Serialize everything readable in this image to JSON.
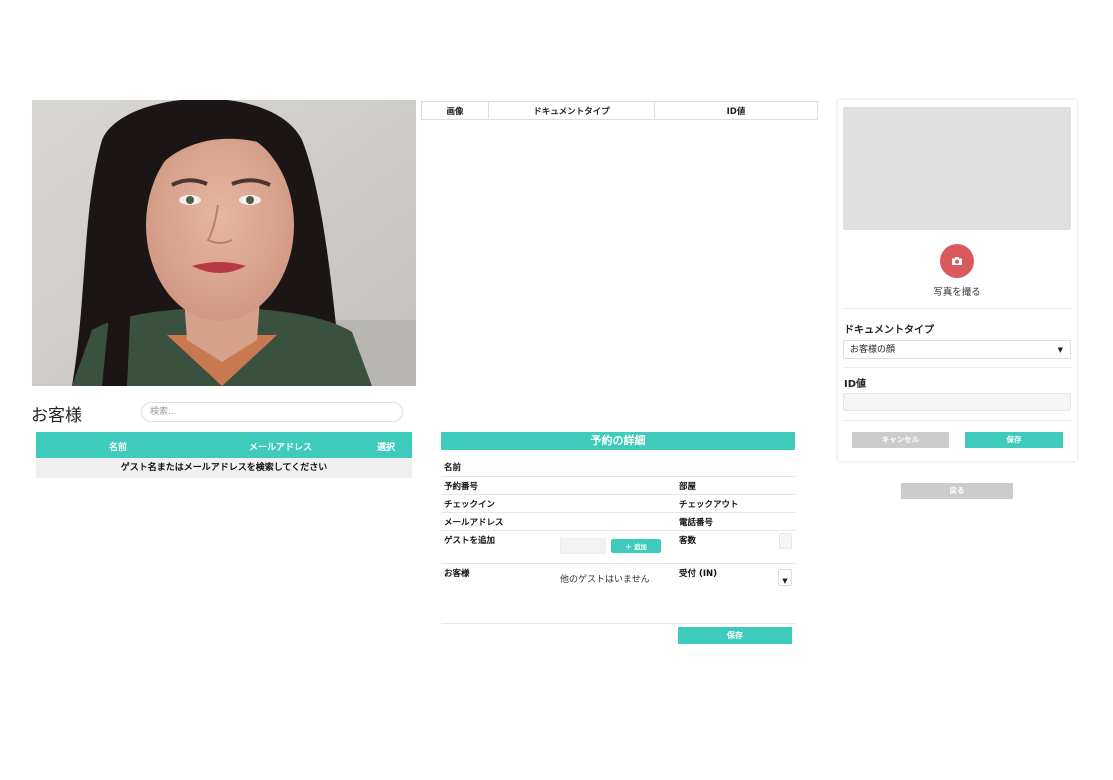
{
  "guests": {
    "title": "お客様",
    "search_placeholder": "検索...",
    "columns": [
      "名前",
      "メールアドレス",
      "選択"
    ],
    "empty_message": "ゲスト名またはメールアドレスを検索してください"
  },
  "documents": {
    "columns": [
      "画像",
      "ドキュメントタイプ",
      "ID値"
    ]
  },
  "reservation": {
    "title": "予約の詳細",
    "name_label": "名前",
    "number_label": "予約番号",
    "room_label": "部屋",
    "checkin_label": "チェックイン",
    "checkout_label": "チェックアウト",
    "email_label": "メールアドレス",
    "phone_label": "電話番号",
    "add_guest_label": "ゲストを追加",
    "add_button": "＋ 追加",
    "guest_count_label": "客数",
    "guests_label": "お客様",
    "no_guests": "他のゲストはいません",
    "reception_label": "受付 (IN)",
    "save_button": "保存"
  },
  "capture": {
    "take_photo_label": "写真を撮る",
    "doctype_label": "ドキュメントタイプ",
    "doctype_value": "お客様の顔",
    "idval_label": "ID値",
    "cancel_button": "キャンセル",
    "save_button": "保存",
    "back_button": "戻る",
    "camera_icon": "camera-icon"
  },
  "colors": {
    "accent": "#3fcbbb",
    "camera": "#d85a5d",
    "disabled": "#cccccc"
  }
}
